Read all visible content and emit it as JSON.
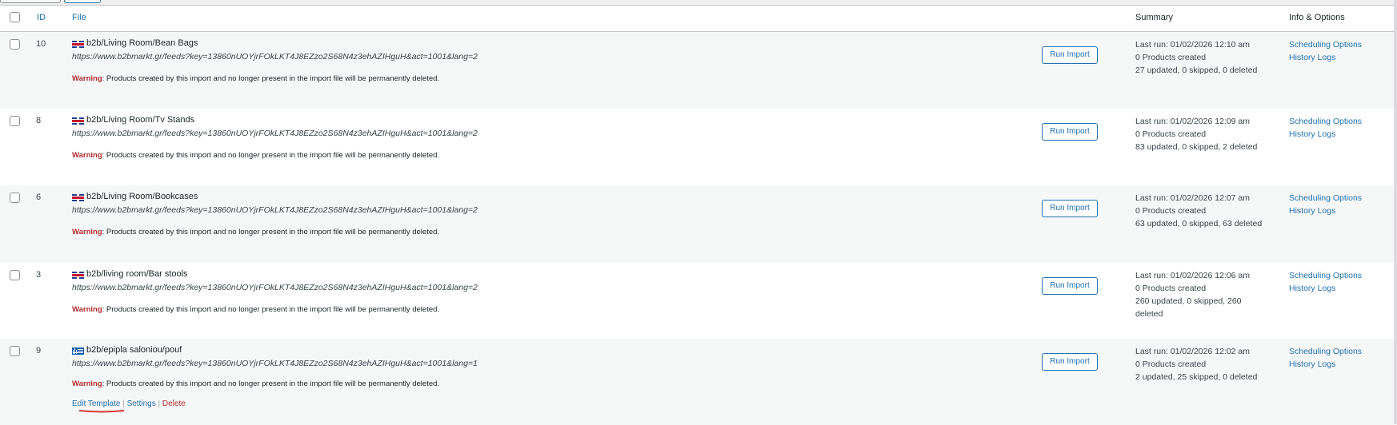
{
  "header": {
    "id": "ID",
    "file": "File",
    "summary": "Summary",
    "info": "Info & Options"
  },
  "warning_label": "Warning",
  "warning_text": ": Products created by this import and no longer present in the import file will be permanently deleted.",
  "run_import_label": "Run Import",
  "scheduling_label": "Scheduling Options",
  "history_label": "History Logs",
  "row_actions": {
    "edit": "Edit Template",
    "settings": "Settings",
    "delete": "Delete"
  },
  "rows": [
    {
      "id": "10",
      "flag": "uk-flag-icon",
      "title": "b2b/Living Room/Bean Bags",
      "url": "https://www.b2bmarkt.gr/feeds?key=13860nUOYjrFOkLKT4J8EZzo2S68N4z3ehAZIHguH&act=1001&lang=2",
      "last_run": "Last run: 01/02/2026 12:10 am",
      "created": "0 Products created",
      "stats": "27 updated, 0 skipped, 0 deleted"
    },
    {
      "id": "8",
      "flag": "uk-flag-icon",
      "title": "b2b/Living Room/Tv Stands",
      "url": "https://www.b2bmarkt.gr/feeds?key=13860nUOYjrFOkLKT4J8EZzo2S68N4z3ehAZIHguH&act=1001&lang=2",
      "last_run": "Last run: 01/02/2026 12:09 am",
      "created": "0 Products created",
      "stats": "83 updated, 0 skipped, 2 deleted"
    },
    {
      "id": "6",
      "flag": "uk-flag-icon",
      "title": "b2b/Living Room/Bookcases",
      "url": "https://www.b2bmarkt.gr/feeds?key=13860nUOYjrFOkLKT4J8EZzo2S68N4z3ehAZIHguH&act=1001&lang=2",
      "last_run": "Last run: 01/02/2026 12:07 am",
      "created": "0 Products created",
      "stats": "63 updated, 0 skipped, 63 deleted"
    },
    {
      "id": "3",
      "flag": "uk-flag-icon",
      "title": "b2b/living room/Bar stools",
      "url": "https://www.b2bmarkt.gr/feeds?key=13860nUOYjrFOkLKT4J8EZzo2S68N4z3ehAZIHguH&act=1001&lang=2",
      "last_run": "Last run: 01/02/2026 12:06 am",
      "created": "0 Products created",
      "stats": "260 updated, 0 skipped, 260 deleted"
    },
    {
      "id": "9",
      "flag": "greek-flag-icon",
      "title": "b2b/epipla saloniou/pouf",
      "url": "https://www.b2bmarkt.gr/feeds?key=13860nUOYjrFOkLKT4J8EZzo2S68N4z3ehAZIHguH&act=1001&lang=1",
      "last_run": "Last run: 01/02/2026 12:02 am",
      "created": "0 Products created",
      "stats": "2 updated, 25 skipped, 0 deleted"
    }
  ],
  "colors": {
    "link": "#2271b1",
    "warning": "#b32d2e",
    "row_alt": "#f6f7f7",
    "annotation": "#d63638"
  }
}
